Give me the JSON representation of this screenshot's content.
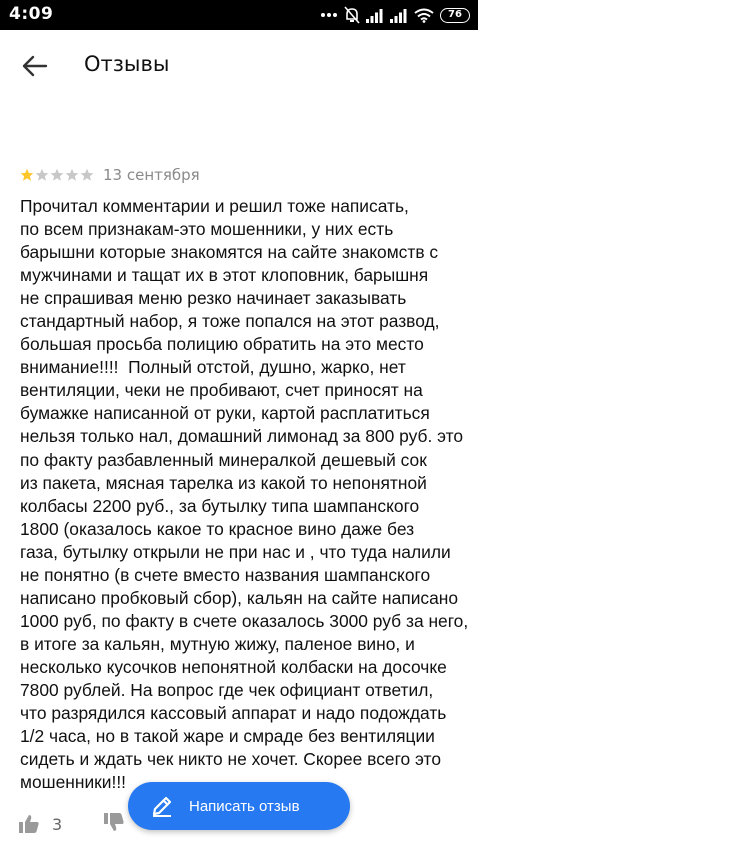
{
  "status_bar": {
    "time": "4:09",
    "battery": "76",
    "icons": [
      "more-dots-icon",
      "alarm-off-icon",
      "cell-signal-icon",
      "cell-signal-icon",
      "wifi-icon",
      "battery-icon"
    ]
  },
  "header": {
    "back_icon": "arrow-left-icon",
    "title": "Отзывы"
  },
  "review": {
    "rating": 1,
    "rating_max": 5,
    "date": "13 сентября",
    "text_lines": [
      "Прочитал комментарии и решил тоже написать,",
      "по всем признакам-это мошенники, у них есть",
      "барышни которые знакомятся на сайте знакомств с",
      "мужчинами и тащат их в этот клоповник, барышня",
      "не спрашивая меню резко начинает заказывать",
      "стандартный набор, я тоже попался на этот развод,",
      "большая просьба полицию обратить на это место",
      "внимание!!!!  Полный отстой, душно, жарко, нет",
      "вентиляции, чеки не пробивают, счет приносят на",
      "бумажке написанной от руки, картой расплатиться",
      "нельзя только нал, домашний лимонад за 800 руб. это",
      "по факту разбавленный минералкой дешевый сок",
      "из пакета, мясная тарелка из какой то непонятной",
      "колбасы 2200 руб., за бутылку типа шампанского",
      "1800 (оказалось какое то красное вино даже без",
      "газа, бутылку открыли не при нас и , что туда налили",
      "не понятно (в счете вместо названия шампанского",
      "написано пробковый сбор), кальян на сайте написано",
      "1000 руб, по факту в счете оказалось 3000 руб за него,",
      "в итоге за кальян, мутную жижу, паленое вино, и",
      "несколько кусочков непонятной колбаски на досочке",
      "7800 рублей. На вопрос где чек официант ответил,",
      "что разрядился кассовый аппарат и надо подождать",
      "1/2 часа, но в такой жаре и смраде без вентиляции",
      "сидеть и ждать чек никто не хочет. Скорее всего это",
      "мошенники!!!"
    ],
    "likes": "3",
    "like_icon": "thumb-up-icon",
    "dislike_icon": "thumb-down-icon"
  },
  "fab": {
    "label": "Написать отзыв",
    "icon": "pencil-icon"
  },
  "colors": {
    "accent": "#2679f1",
    "star_filled": "#fdc62a",
    "star_empty": "#c8c8c8",
    "meta_text": "#8a8a8a"
  }
}
